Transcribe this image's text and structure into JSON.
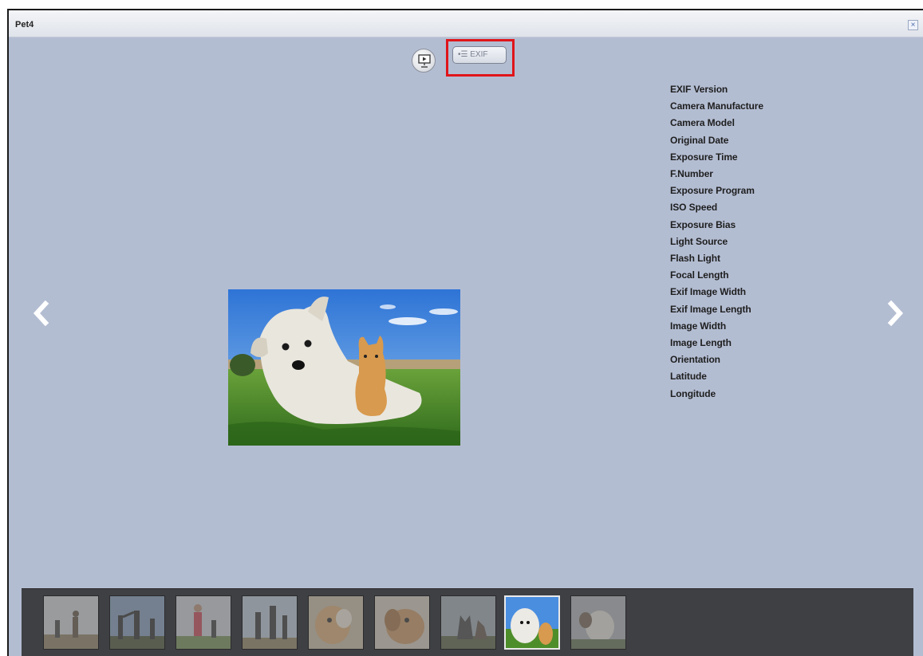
{
  "window": {
    "title": "Pet4",
    "close_label": "×"
  },
  "toolbar": {
    "exif_button_label": "EXIF",
    "exif_icon": "list-icon",
    "slideshow_icon": "slideshow-icon"
  },
  "exif_fields": [
    "EXIF Version",
    "Camera Manufacture",
    "Camera Model",
    "Original Date",
    "Exposure Time",
    "F.Number",
    "Exposure Program",
    "ISO Speed",
    "Exposure Bias",
    "Light Source",
    "Flash Light",
    "Focal Length",
    "Exif Image Width",
    "Exif Image Length",
    "Image Width",
    "Image Length",
    "Orientation",
    "Latitude",
    "Longitude"
  ],
  "navigation": {
    "prev_icon": "chevron-left-icon",
    "next_icon": "chevron-right-icon"
  },
  "thumbnails": {
    "count": 9,
    "selected_index": 7
  },
  "colors": {
    "background": "#b3bdd2",
    "highlight": "#e0151a",
    "thumbstrip": "#3f4044"
  }
}
